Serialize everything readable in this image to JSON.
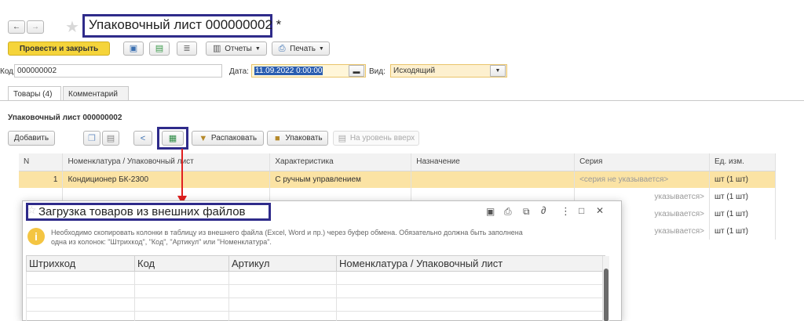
{
  "nav": {
    "back": "←",
    "forward": "→",
    "star": "★"
  },
  "window_title": "Упаковочный лист 000000002 *",
  "toolbar": {
    "post_close": "Провести и закрыть",
    "reports": "Отчеты",
    "print": "Печать"
  },
  "header_fields": {
    "code_label": "Код:",
    "code_value": "000000002",
    "date_label": "Дата:",
    "date_value": "11.09.2022  0:00:00",
    "type_label": "Вид:",
    "type_value": "Исходящий"
  },
  "tabs": [
    {
      "label": "Товары (4)"
    },
    {
      "label": "Комментарий"
    }
  ],
  "section_title": "Упаковочный лист 000000002",
  "table_toolbar": {
    "add": "Добавить",
    "unpack": "Распаковать",
    "pack": "Упаковать",
    "level_up": "На уровень вверх"
  },
  "table": {
    "columns": [
      "N",
      "Номенклатура / Упаковочный лист",
      "Характеристика",
      "Назначение",
      "Серия",
      "Ед. изм."
    ],
    "rows": [
      {
        "n": "1",
        "item": "Кондиционер БК-2300",
        "char": "С ручным управлением",
        "purpose": "",
        "series": "<серия не указывается>",
        "unit": "шт (1 шт)"
      },
      {
        "n": "",
        "item": "",
        "char": "",
        "purpose": "",
        "series": "указывается>",
        "unit": "шт (1 шт)"
      },
      {
        "n": "",
        "item": "",
        "char": "",
        "purpose": "",
        "series": "указывается>",
        "unit": "шт (1 шт)"
      },
      {
        "n": "",
        "item": "",
        "char": "",
        "purpose": "",
        "series": "указывается>",
        "unit": "шт (1 шт)"
      }
    ]
  },
  "dialog": {
    "title": "Загрузка товаров из внешних файлов",
    "info_line1": "Необходимо скопировать колонки в таблицу из внешнего файла (Excel, Word и пр.) через буфер обмена. Обязательно должна быть заполнена",
    "info_line2": "одна из колонок: \"Штрихкод\", \"Код\", \"Артикул\" или \"Номенклатура\".",
    "columns": [
      "Штрихкод",
      "Код",
      "Артикул",
      "Номенклатура / Упаковочный лист"
    ],
    "menu_glyph": "⋮",
    "minimize_glyph": "□",
    "close_glyph": "✕"
  },
  "colors": {
    "accent_yellow": "#f5d43a",
    "selected_row": "#fbe3a4",
    "highlight_frame": "#2f2b8a",
    "arrow_red": "#e02020"
  }
}
